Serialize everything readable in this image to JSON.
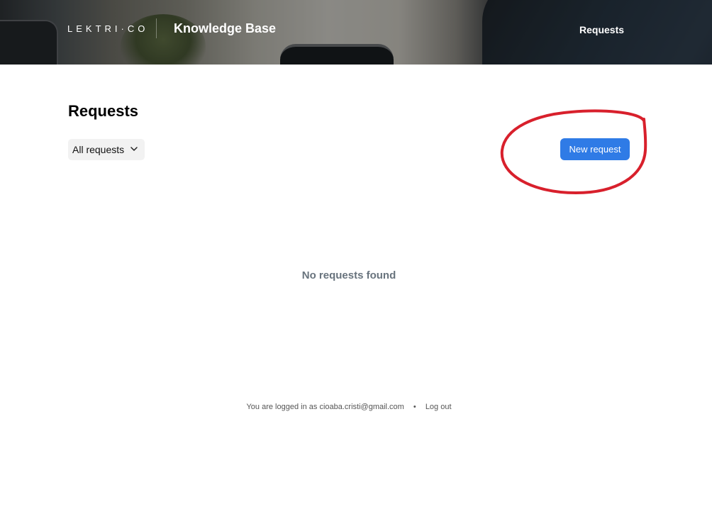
{
  "header": {
    "logo_text": "LEKTRI·CO",
    "title": "Knowledge Base",
    "nav_requests": "Requests"
  },
  "main": {
    "title": "Requests",
    "filter": {
      "selected": "All requests"
    },
    "new_request_label": "New request",
    "empty_message": "No requests found"
  },
  "footer": {
    "logged_in_prefix": "You are logged in as",
    "email": "cioaba.cristi@gmail.com",
    "separator": "•",
    "logout_label": "Log out"
  },
  "colors": {
    "primary_button": "#2f7be6",
    "annotation_circle": "#d8202c"
  },
  "icons": {
    "filter_dropdown": "chevron-down-icon"
  }
}
